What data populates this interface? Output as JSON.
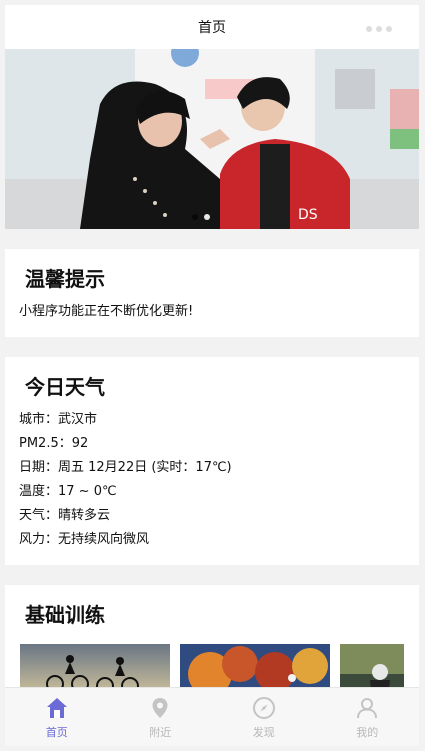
{
  "navbar": {
    "title": "首页"
  },
  "banner": {
    "description_icon": "photo"
  },
  "tips": {
    "title": "温馨提示",
    "text": "小程序功能正在不断优化更新!"
  },
  "weather": {
    "title": "今日天气",
    "city": "城市：武汉市",
    "pm25": "PM2.5：92",
    "date": "日期：周五 12月22日 (实时：17℃)",
    "temp": "温度：17 ~ 0℃",
    "condition": "天气：晴转多云",
    "wind": "风力：无持续风向微风"
  },
  "training": {
    "title": "基础训练"
  },
  "tabbar": {
    "items": [
      {
        "label": "首页",
        "icon": "home-icon",
        "active": true
      },
      {
        "label": "附近",
        "icon": "location-icon",
        "active": false
      },
      {
        "label": "发现",
        "icon": "compass-icon",
        "active": false
      },
      {
        "label": "我的",
        "icon": "user-icon",
        "active": false
      }
    ]
  },
  "colors": {
    "accent": "#6b6bd8",
    "inactive": "#b8b8b8",
    "divider": "#f2f2f2"
  }
}
